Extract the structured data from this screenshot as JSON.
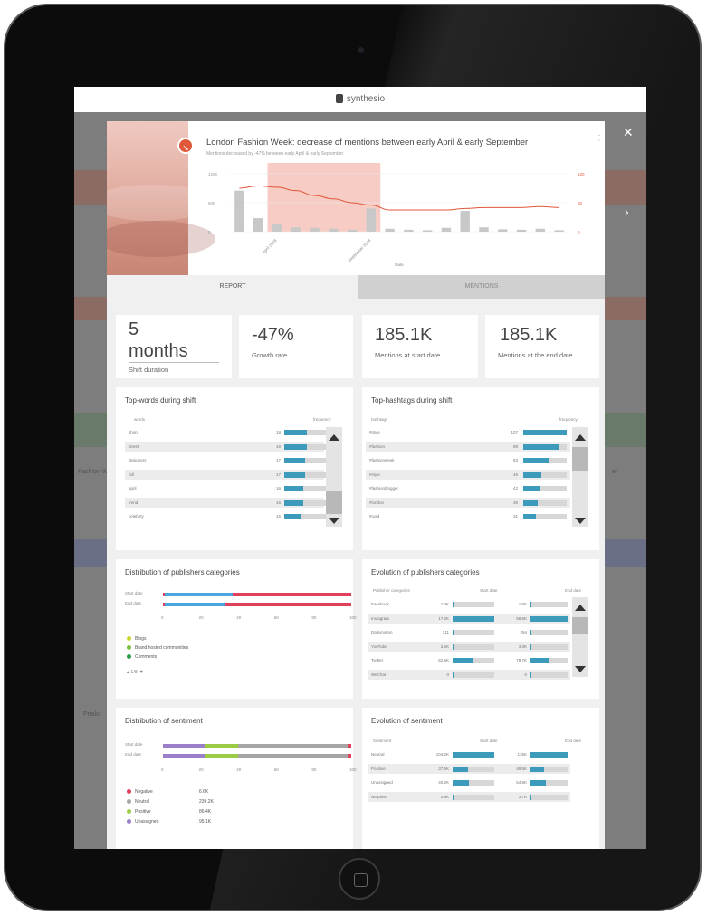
{
  "app": {
    "brand": "synthesio"
  },
  "hero": {
    "title": "London Fashion Week: decrease of mentions between early April & early September",
    "subtitle": "Mentions decreased by -47% between early April & early September",
    "badge_icon": "trend-down-icon",
    "menu_icon": "kebab-icon"
  },
  "chart_data": {
    "type": "bar",
    "x": [
      "April 2018",
      "",
      "",
      "",
      "",
      "",
      "",
      "September 2018",
      "",
      "",
      "",
      "",
      "",
      "",
      "",
      "",
      "",
      ""
    ],
    "x_tick_labels": [
      "April 2018",
      "September 2018"
    ],
    "values": [
      85000,
      28000,
      15000,
      9000,
      8000,
      6000,
      4000,
      48000,
      6000,
      4000,
      3000,
      8000,
      43000,
      9000,
      5000,
      4000,
      6000,
      3000
    ],
    "line_values": [
      90,
      95,
      92,
      85,
      75,
      68,
      60,
      55,
      45,
      45,
      45,
      45,
      48,
      50,
      50,
      50,
      52,
      50
    ],
    "highlight_range": [
      2,
      7
    ],
    "ylim": [
      0,
      120000
    ],
    "y_ticks": [
      "120K",
      "60K",
      "0"
    ],
    "y2_ticks": [
      "120",
      "60",
      "0"
    ],
    "xlabel": "Date",
    "bar_color": "#c8c8c8",
    "line_color": "#e0573a",
    "highlight_color": "#f4c3ba"
  },
  "tabs": {
    "report": "REPORT",
    "mentions": "MENTIONS"
  },
  "kpis": [
    {
      "value": "5 months",
      "value_line1": "5",
      "value_line2": "months",
      "label": "Shift duration"
    },
    {
      "value": "-47%",
      "label": "Growth rate"
    },
    {
      "value": "185.1K",
      "label": "Mentions at start date"
    },
    {
      "value": "185.1K",
      "label": "Mentions at the end date"
    }
  ],
  "top_words": {
    "title": "Top-words during shift",
    "col_word": "words",
    "col_freq": "frequency",
    "rows": [
      {
        "label": "shop",
        "value": "18",
        "fill": 0.55
      },
      {
        "label": "street",
        "value": "18",
        "fill": 0.55
      },
      {
        "label": "designers",
        "value": "17",
        "fill": 0.5
      },
      {
        "label": "fall",
        "value": "17",
        "fill": 0.5
      },
      {
        "label": "april",
        "value": "16",
        "fill": 0.45
      },
      {
        "label": "trend",
        "value": "16",
        "fill": 0.45
      },
      {
        "label": "celebrity",
        "value": "15",
        "fill": 0.42
      }
    ]
  },
  "top_hashtags": {
    "title": "Top-hashtags during shift",
    "col_word": "hashtags",
    "col_freq": "frequency",
    "rows": [
      {
        "label": "#style",
        "value": "107",
        "fill": 1.0
      },
      {
        "label": "#fashion",
        "value": "88",
        "fill": 0.82
      },
      {
        "label": "#fashionweek",
        "value": "63",
        "fill": 0.6
      },
      {
        "label": "#style",
        "value": "45",
        "fill": 0.42
      },
      {
        "label": "#fashionblogger",
        "value": "42",
        "fill": 0.4
      },
      {
        "label": "#london",
        "value": "36",
        "fill": 0.34
      },
      {
        "label": "#ootd",
        "value": "31",
        "fill": 0.29
      }
    ]
  },
  "publisher_dist": {
    "title": "Distribution of publishers categories",
    "rows": [
      {
        "label": "Start date",
        "blue": 0.36
      },
      {
        "label": "End date",
        "blue": 0.32
      }
    ],
    "ticks": [
      "0",
      "20",
      "40",
      "60",
      "80",
      "100"
    ],
    "legend": [
      {
        "label": "Blogs",
        "color": "#c8d92b"
      },
      {
        "label": "Brand hosted communities",
        "color": "#7cbf3a"
      },
      {
        "label": "Comments",
        "color": "#2e9a4d"
      }
    ],
    "pager": "1/8"
  },
  "publisher_evo": {
    "title": "Evolution of publishers categories",
    "col_cat": "Publisher categories",
    "col_start": "Start date",
    "col_end": "End date",
    "rows": [
      {
        "label": "Facebook",
        "start": "1.3K",
        "sfill": 0.0,
        "end": "1.6K",
        "efill": 0.0
      },
      {
        "label": "Instagram",
        "start": "17.2K",
        "sfill": 1.0,
        "end": "58.5K",
        "efill": 1.0
      },
      {
        "label": "Dailymotion",
        "start": "211",
        "sfill": 0.0,
        "end": "294",
        "efill": 0.0
      },
      {
        "label": "YouTube",
        "start": "2.2K",
        "sfill": 0.02,
        "end": "3.3K",
        "efill": 0.02
      },
      {
        "label": "Twitter",
        "start": "62.5K",
        "sfill": 0.5,
        "end": "78.7K",
        "efill": 0.48
      },
      {
        "label": "WeChat",
        "start": "0",
        "sfill": 0.0,
        "end": "0",
        "efill": 0.0
      }
    ]
  },
  "sentiment_dist": {
    "title": "Distribution of sentiment",
    "rows": [
      {
        "label": "Start date"
      },
      {
        "label": "End date"
      }
    ],
    "ticks": [
      "0",
      "20",
      "40",
      "60",
      "80",
      "100"
    ],
    "legend": [
      {
        "label": "Negative",
        "value": "6.6K",
        "color": "#e0405a"
      },
      {
        "label": "Neutral",
        "value": "239.2K",
        "color": "#a6a6a6"
      },
      {
        "label": "Positive",
        "value": "86.4K",
        "color": "#9ccc45"
      },
      {
        "label": "Unassigned",
        "value": "95.1K",
        "color": "#9b7fc8"
      }
    ]
  },
  "sentiment_evo": {
    "title": "Evolution of sentiment",
    "col_cat": "Sentiment",
    "col_start": "Start date",
    "col_end": "End date",
    "rows": [
      {
        "label": "Neutral",
        "start": "104.2K",
        "sfill": 1.0,
        "end": "135K",
        "efill": 1.0
      },
      {
        "label": "Positive",
        "start": "37.5K",
        "sfill": 0.38,
        "end": "48.5K",
        "efill": 0.36
      },
      {
        "label": "Unassigned",
        "start": "40.2K",
        "sfill": 0.4,
        "end": "54.5K",
        "efill": 0.4
      },
      {
        "label": "Negative",
        "start": "2.8K",
        "sfill": 0.03,
        "end": "3.7K",
        "efill": 0.03
      }
    ]
  },
  "background": {
    "left_text_1": "Fashion We",
    "left_text_2": "Peaks",
    "right_text": "er"
  }
}
